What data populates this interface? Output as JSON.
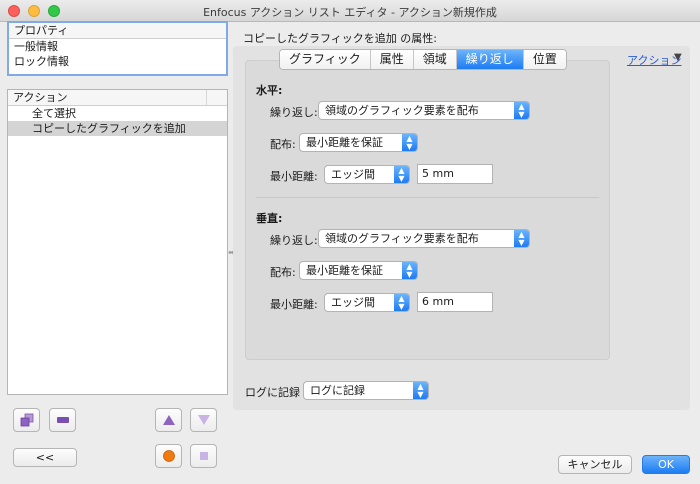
{
  "window": {
    "title": "Enfocus アクション リスト エディタ - アクション新規作成"
  },
  "properties": {
    "header": "プロパティ",
    "items": [
      "一般情報",
      "ロック情報"
    ]
  },
  "actions": {
    "header": "アクション",
    "items": [
      "全て選択",
      "コピーしたグラフィックを追加"
    ]
  },
  "left_buttons": {
    "back_label": "<<"
  },
  "attributes": {
    "title": "コピーしたグラフィックを追加 の属性:",
    "tabs": [
      "グラフィック",
      "属性",
      "領域",
      "繰り返し",
      "位置"
    ],
    "active_tab": "繰り返し",
    "action_menu": "アクション",
    "action_menu_arrow": "▼"
  },
  "horizontal": {
    "heading": "水平:",
    "repeat_label": "繰り返し:",
    "repeat_value": "領域のグラフィック要素を配布",
    "dist_label": "配布:",
    "dist_value": "最小距離を保証",
    "min_label": "最小距離:",
    "min_type": "エッジ間",
    "min_value": "5 mm"
  },
  "vertical": {
    "heading": "垂直:",
    "repeat_label": "繰り返し:",
    "repeat_value": "領域のグラフィック要素を配布",
    "dist_label": "配布:",
    "dist_value": "最小距離を保証",
    "min_label": "最小距離:",
    "min_type": "エッジ間",
    "min_value": "6 mm"
  },
  "log": {
    "label": "ログに記録",
    "value": "ログに記録"
  },
  "footer": {
    "cancel": "キャンセル",
    "ok": "OK"
  },
  "colors": {
    "accent": "#1d7cf2",
    "link": "#2b5bd5",
    "selection": "#d4d4d4"
  }
}
